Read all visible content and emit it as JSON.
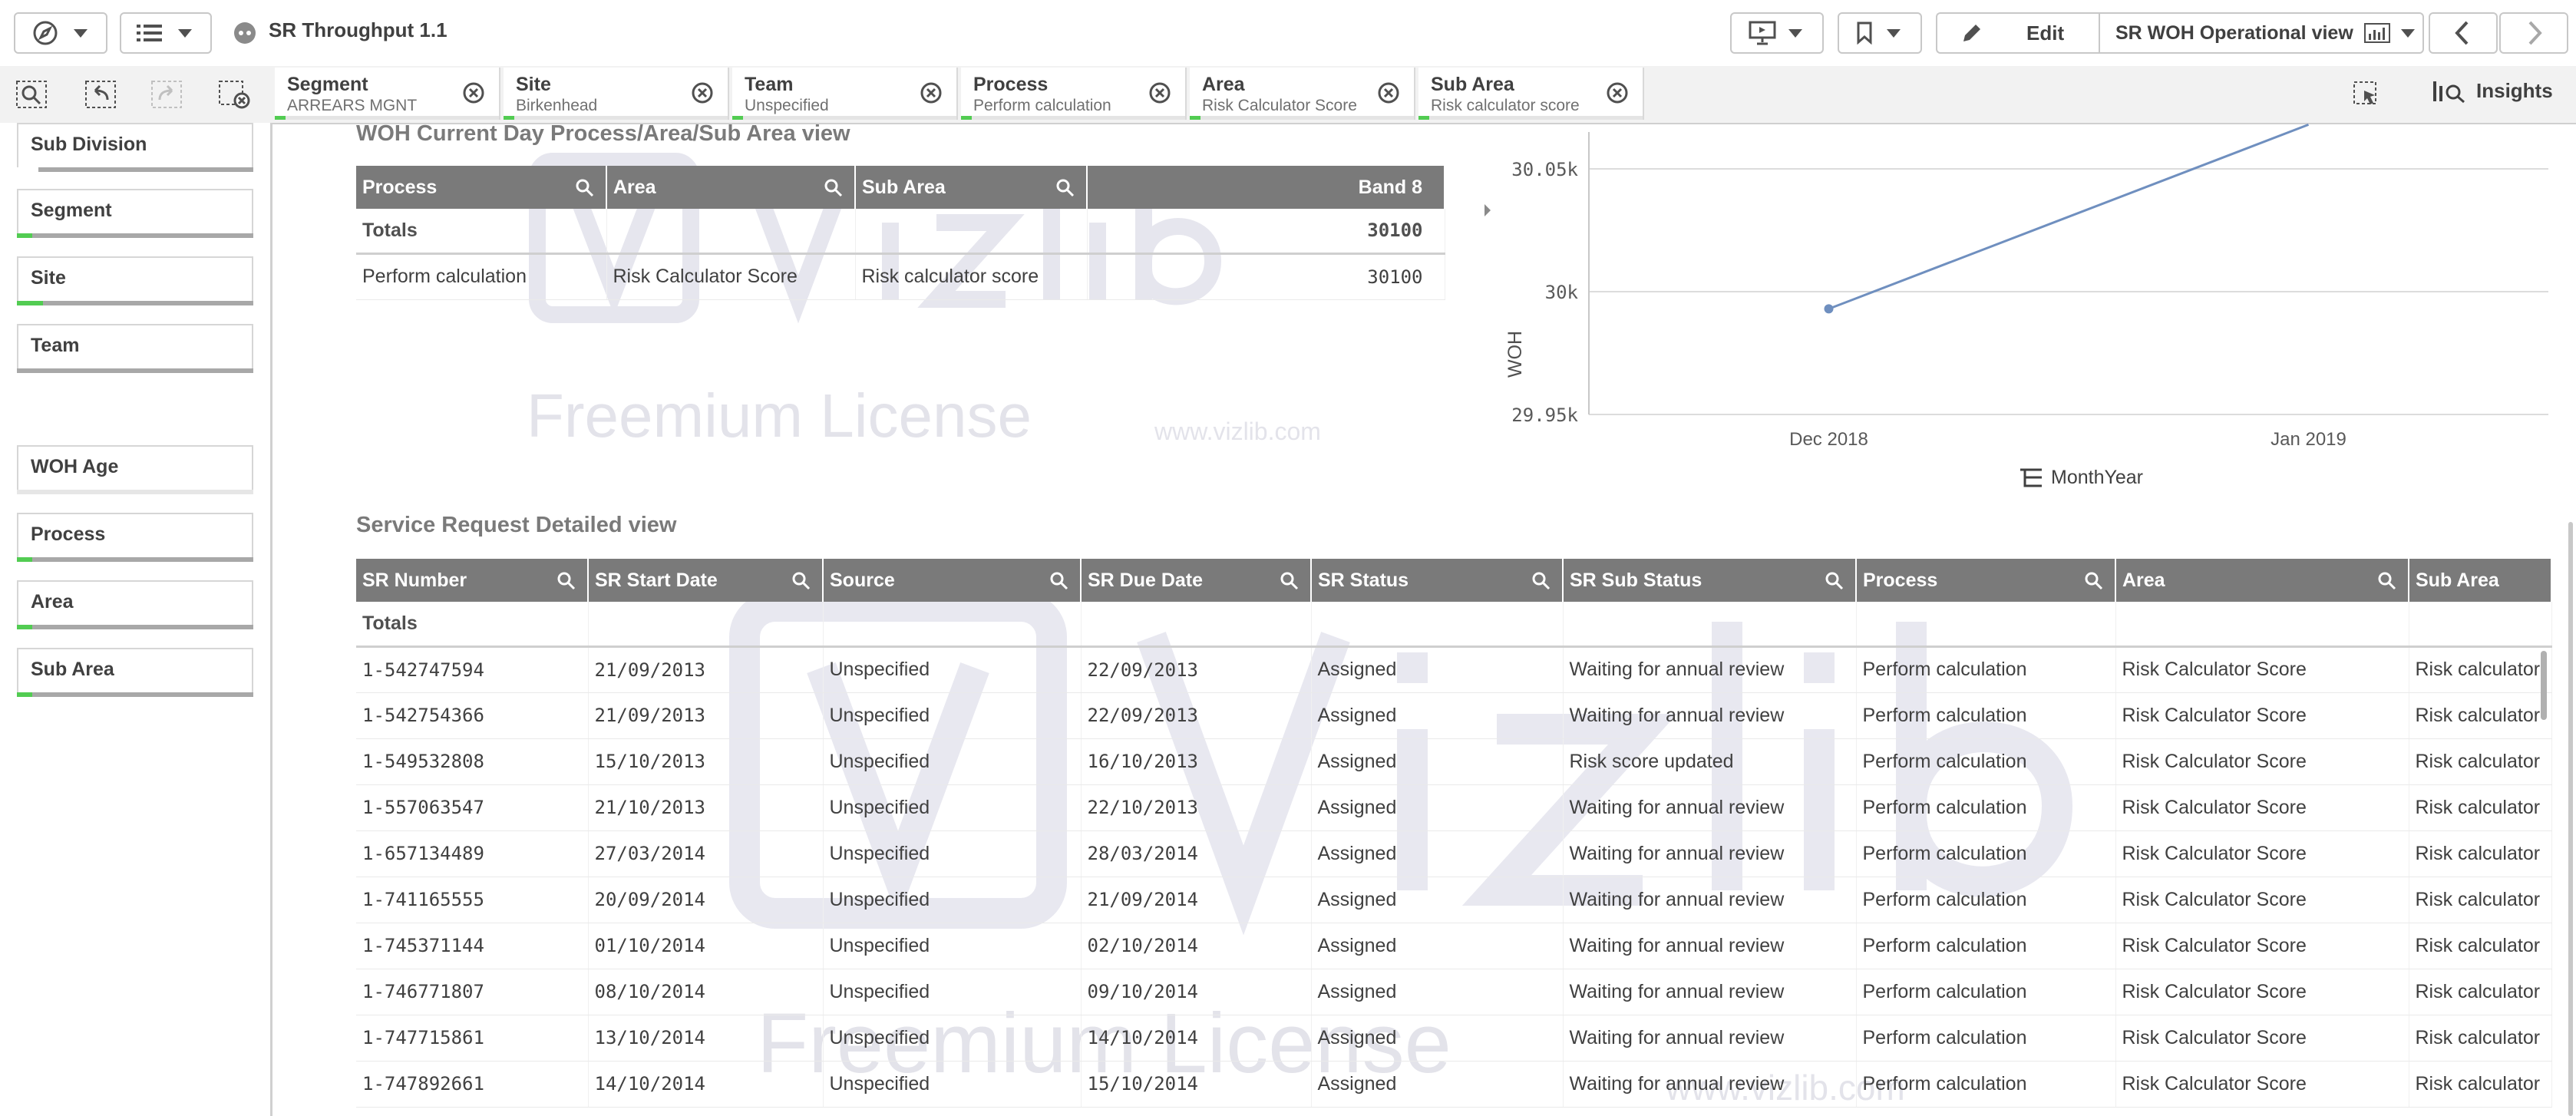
{
  "app": {
    "title": "SR Throughput 1.1"
  },
  "toolbar": {
    "edit_label": "Edit",
    "sheet_name": "SR WOH Operational view",
    "insights_label": "Insights",
    "icons": [
      "compass-icon",
      "list-icon",
      "app-icon",
      "presentation-icon",
      "bookmark-icon",
      "pencil-icon",
      "chart-icon",
      "chevron-left-icon",
      "chevron-right-icon"
    ]
  },
  "selections": [
    {
      "title": "Segment",
      "value": "ARREARS MGNT"
    },
    {
      "title": "Site",
      "value": "Birkenhead"
    },
    {
      "title": "Team",
      "value": "Unspecified"
    },
    {
      "title": "Process",
      "value": "Perform calculation"
    },
    {
      "title": "Area",
      "value": "Risk Calculator Score"
    },
    {
      "title": "Sub Area",
      "value": "Risk calculator score"
    }
  ],
  "filters": [
    "Sub Division",
    "Segment",
    "Site",
    "Team",
    "WOH Age",
    "Process",
    "Area",
    "Sub Area"
  ],
  "summary_table": {
    "title": "WOH Current Day Process/Area/Sub Area view",
    "columns": [
      "Process",
      "Area",
      "Sub Area",
      "Band 8"
    ],
    "totals_label": "Totals",
    "totals_value": "30100",
    "rows": [
      [
        "Perform calculation",
        "Risk Calculator Score",
        "Risk calculator score",
        "30100"
      ]
    ]
  },
  "chart_data": {
    "type": "line",
    "x": [
      "Dec 2018",
      "Jan 2019"
    ],
    "series": [
      {
        "values": [
          29993,
          30068
        ]
      }
    ],
    "ylabel": "WOH",
    "xlabel": "MonthYear",
    "y_ticks": [
      "30.05k",
      "30k",
      "29.95k"
    ],
    "ylim": [
      29950,
      30065
    ],
    "grid": true,
    "line_color": "#6f8fbf"
  },
  "detail_table": {
    "title": "Service Request Detailed view",
    "columns": [
      "SR Number",
      "SR Start Date",
      "Source",
      "SR Due Date",
      "SR Status",
      "SR Sub Status",
      "Process",
      "Area",
      "Sub Area"
    ],
    "totals_label": "Totals",
    "rows": [
      [
        "1-542747594",
        "21/09/2013",
        "Unspecified",
        "22/09/2013",
        "Assigned",
        "Waiting for annual review",
        "Perform calculation",
        "Risk Calculator Score",
        "Risk calculator"
      ],
      [
        "1-542754366",
        "21/09/2013",
        "Unspecified",
        "22/09/2013",
        "Assigned",
        "Waiting for annual review",
        "Perform calculation",
        "Risk Calculator Score",
        "Risk calculator"
      ],
      [
        "1-549532808",
        "15/10/2013",
        "Unspecified",
        "16/10/2013",
        "Assigned",
        "Risk score updated",
        "Perform calculation",
        "Risk Calculator Score",
        "Risk calculator"
      ],
      [
        "1-557063547",
        "21/10/2013",
        "Unspecified",
        "22/10/2013",
        "Assigned",
        "Waiting for annual review",
        "Perform calculation",
        "Risk Calculator Score",
        "Risk calculator"
      ],
      [
        "1-657134489",
        "27/03/2014",
        "Unspecified",
        "28/03/2014",
        "Assigned",
        "Waiting for annual review",
        "Perform calculation",
        "Risk Calculator Score",
        "Risk calculator"
      ],
      [
        "1-741165555",
        "20/09/2014",
        "Unspecified",
        "21/09/2014",
        "Assigned",
        "Waiting for annual review",
        "Perform calculation",
        "Risk Calculator Score",
        "Risk calculator"
      ],
      [
        "1-745371144",
        "01/10/2014",
        "Unspecified",
        "02/10/2014",
        "Assigned",
        "Waiting for annual review",
        "Perform calculation",
        "Risk Calculator Score",
        "Risk calculator"
      ],
      [
        "1-746771807",
        "08/10/2014",
        "Unspecified",
        "09/10/2014",
        "Assigned",
        "Waiting for annual review",
        "Perform calculation",
        "Risk Calculator Score",
        "Risk calculator"
      ],
      [
        "1-747715861",
        "13/10/2014",
        "Unspecified",
        "14/10/2014",
        "Assigned",
        "Waiting for annual review",
        "Perform calculation",
        "Risk Calculator Score",
        "Risk calculator"
      ],
      [
        "1-747892661",
        "14/10/2014",
        "Unspecified",
        "15/10/2014",
        "Assigned",
        "Waiting for annual review",
        "Perform calculation",
        "Risk Calculator Score",
        "Risk calculator"
      ]
    ]
  },
  "watermark": {
    "brand": "vizlib",
    "license": "Freemium License",
    "url": "www.vizlib.com"
  }
}
